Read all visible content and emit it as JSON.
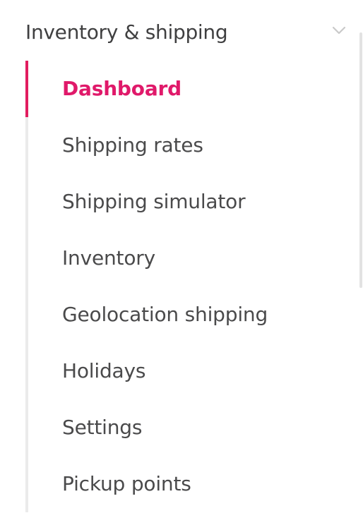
{
  "section": {
    "title": "Inventory & shipping",
    "expanded_icon": "chevron-down-icon"
  },
  "nav": {
    "active_index": 0,
    "accent_color": "#e0196a",
    "items": [
      {
        "label": "Dashboard"
      },
      {
        "label": "Shipping rates"
      },
      {
        "label": "Shipping simulator"
      },
      {
        "label": "Inventory"
      },
      {
        "label": "Geolocation shipping"
      },
      {
        "label": "Holidays"
      },
      {
        "label": "Settings"
      },
      {
        "label": "Pickup points"
      }
    ]
  }
}
